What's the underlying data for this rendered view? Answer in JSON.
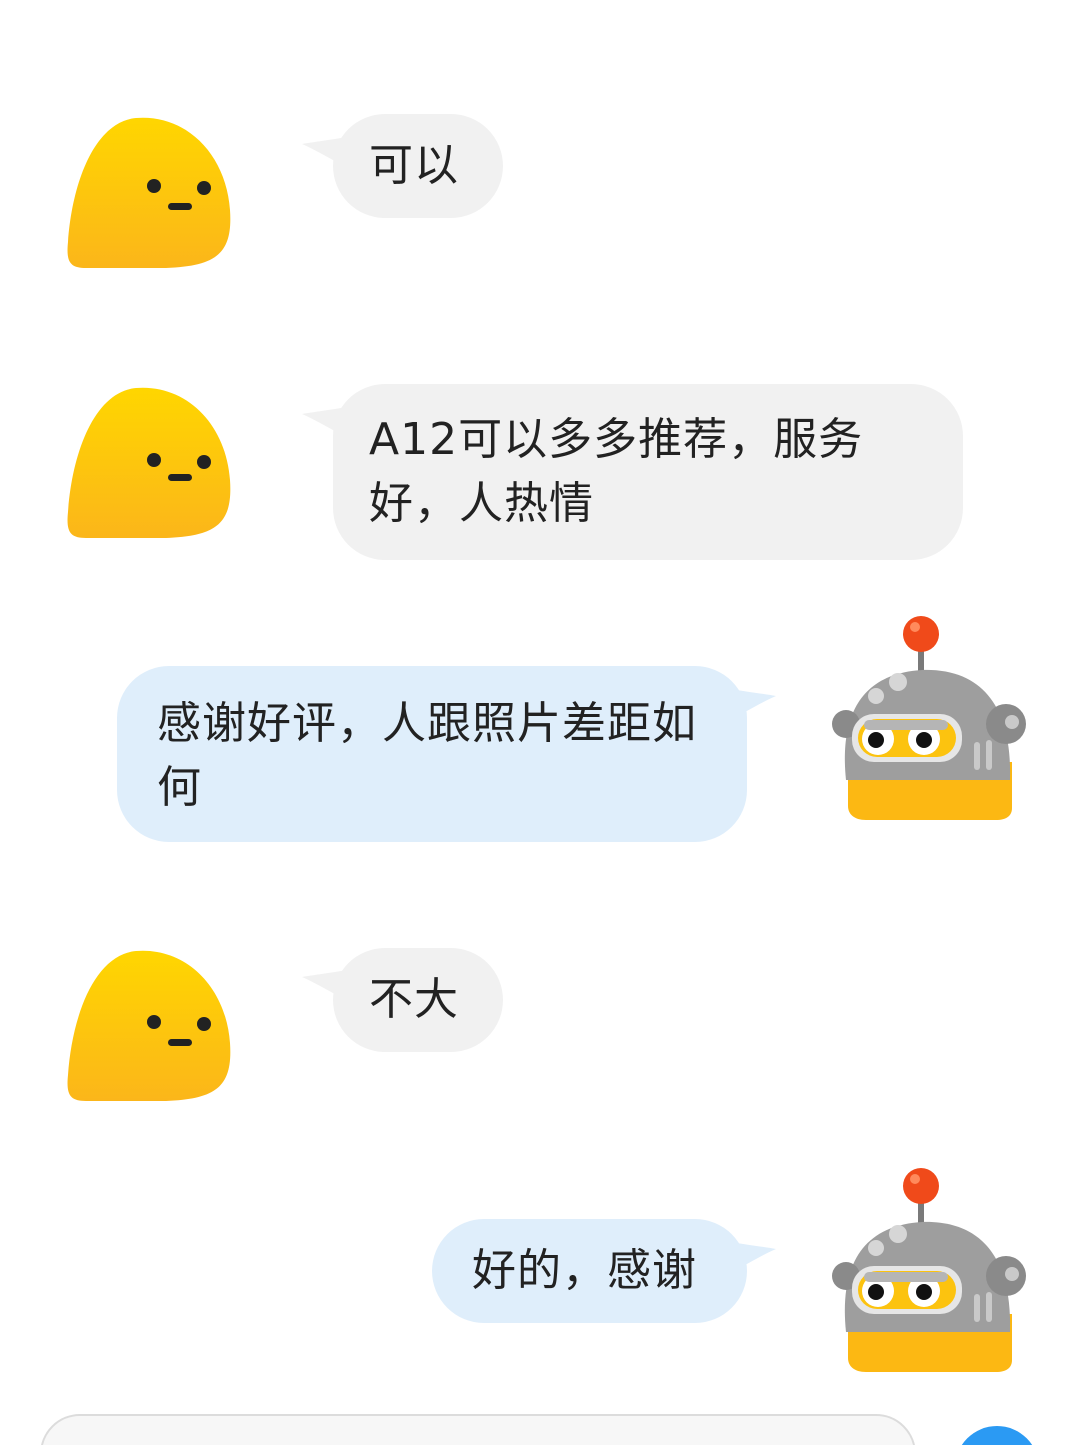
{
  "colors": {
    "incoming_bubble": "#f1f1f1",
    "outgoing_bubble": "#dfeefb",
    "user_avatar": "#fcc30f",
    "robot_body": "#9e9e9e",
    "robot_antenna": "#f04a1a",
    "send_button": "#2b9af3"
  },
  "icons": {
    "user_avatar": "yellow-blob-face-avatar",
    "bot_avatar": "robot-head-avatar"
  },
  "messages": [
    {
      "side": "incoming",
      "text": "可以"
    },
    {
      "side": "incoming",
      "text": "A12可以多多推荐，服务好，人热情"
    },
    {
      "side": "outgoing",
      "text": "感谢好评，人跟照片差距如何"
    },
    {
      "side": "incoming",
      "text": "不大"
    },
    {
      "side": "outgoing",
      "text": "好的，感谢"
    }
  ],
  "composer": {
    "input_value": ""
  }
}
